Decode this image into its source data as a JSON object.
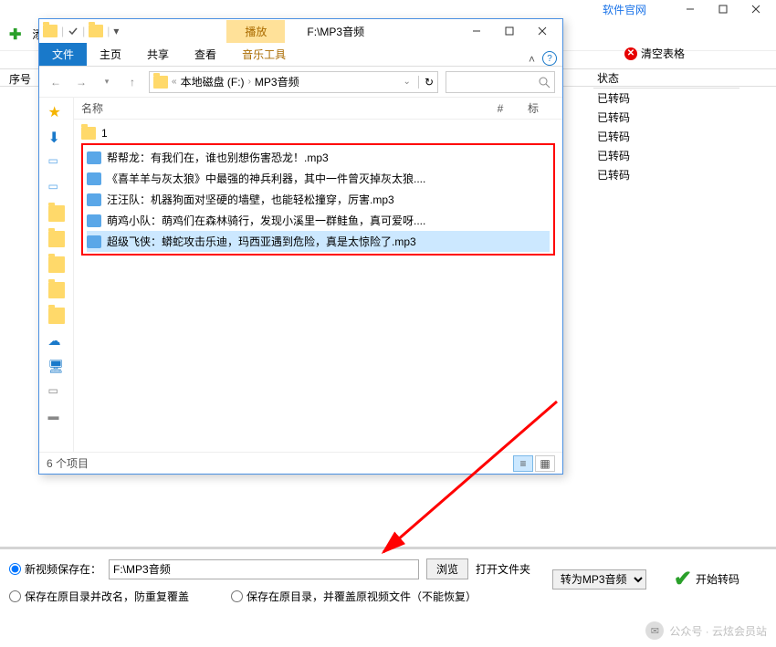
{
  "bgApp": {
    "websiteLink": "软件官网",
    "addLabel": "添加",
    "clearLabel": "清空表格",
    "seqHeader": "序号",
    "statusHeader": "状态",
    "statusValues": [
      "已转码",
      "已转码",
      "已转码",
      "已转码",
      "已转码"
    ]
  },
  "bottom": {
    "saveNewLabel": "新视频保存在：",
    "savePath": "F:\\MP3音频",
    "browseLabel": "浏览",
    "openFolderLabel": "打开文件夹",
    "saveRenameLabel": "保存在原目录并改名，防重复覆盖",
    "saveOverwriteLabel": "保存在原目录，并覆盖原视频文件（不能恢复）",
    "convertOption": "转为MP3音频",
    "startLabel": "开始转码"
  },
  "explorer": {
    "playTab": "播放",
    "titlePath": "F:\\MP3音频",
    "tabs": {
      "file": "文件",
      "home": "主页",
      "share": "共享",
      "view": "查看",
      "music": "音乐工具"
    },
    "nav": {
      "seg1": "本地磁盘 (F:)",
      "seg2": "MP3音频"
    },
    "cols": {
      "name": "名称",
      "hash": "#",
      "mark": "标"
    },
    "folder1": "1",
    "files": [
      "帮帮龙：有我们在，谁也别想伤害恐龙！.mp3",
      "《喜羊羊与灰太狼》中最强的神兵利器，其中一件曾灭掉灰太狼....",
      "汪汪队：机器狗面对坚硬的墙壁，也能轻松撞穿，厉害.mp3",
      "萌鸡小队：萌鸡们在森林骑行，发现小溪里一群鲑鱼，真可爱呀....",
      "超级飞侠：蟒蛇攻击乐迪，玛西亚遇到危险，真是太惊险了.mp3"
    ],
    "statusText": "6 个项目"
  },
  "watermark": "公众号 · 云炫会员站"
}
